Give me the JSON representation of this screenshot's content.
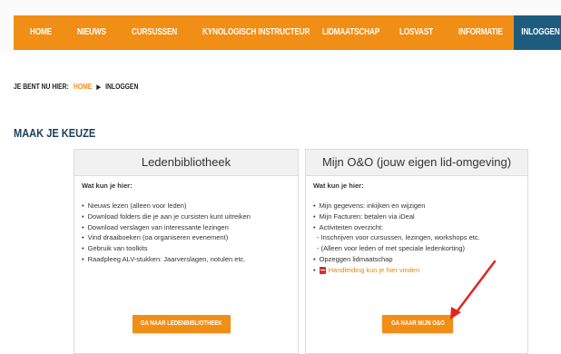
{
  "nav": {
    "items": [
      "HOME",
      "NIEUWS",
      "CURSUSSEN",
      "KYNOLOGISCH INSTRUCTEUR",
      "LIDMAATSCHAP",
      "LOSVAST",
      "INFORMATIE"
    ],
    "active": "INLOGGEN"
  },
  "breadcrumb": {
    "prefix": "JE BENT NU HIER:",
    "home": "HOME",
    "current": "INLOGGEN"
  },
  "heading": "MAAK JE KEUZE",
  "left_panel": {
    "title": "Ledenbibliotheek",
    "subtitle": "Wat kun je hier:",
    "items": [
      "Nieuws lezen (alleen voor leden)",
      "Download folders die je aan je cursisten kunt uitreiken",
      "Download verslagen van interessante lezingen",
      "Vind draaiboeken (oa organiseren evenement)",
      "Gebruik van toolkits",
      "Raadpleeg ALV-stukken: Jaarverslagen, notulen etc."
    ],
    "button": "GA NAAR LEDENBIBLIOTHEEK"
  },
  "right_panel": {
    "title": "Mijn O&O (jouw eigen lid-omgeving)",
    "subtitle": "Wat kun je hier:",
    "items": [
      "Mijn gegevens: inkijken en wijzigen",
      "Mijn Facturen: betalen via iDeal",
      "Activiteiten overzicht:"
    ],
    "sub_items": [
      "- Inschrijven voor cursussen, lezingen, workshops etc.",
      "- (Alleen voor leden of met speciale ledenkorting)"
    ],
    "extra_item": "Opzeggen lidmaatschap",
    "link": "Handleiding kun je hier vinden",
    "button": "GA NAAR MIJN O&O"
  },
  "colors": {
    "accent": "#f18e16",
    "nav_active": "#1d5c7d",
    "heading": "#1d3f5a",
    "arrow": "#e3261c"
  },
  "icons": {
    "pdf": "pdf-icon"
  }
}
